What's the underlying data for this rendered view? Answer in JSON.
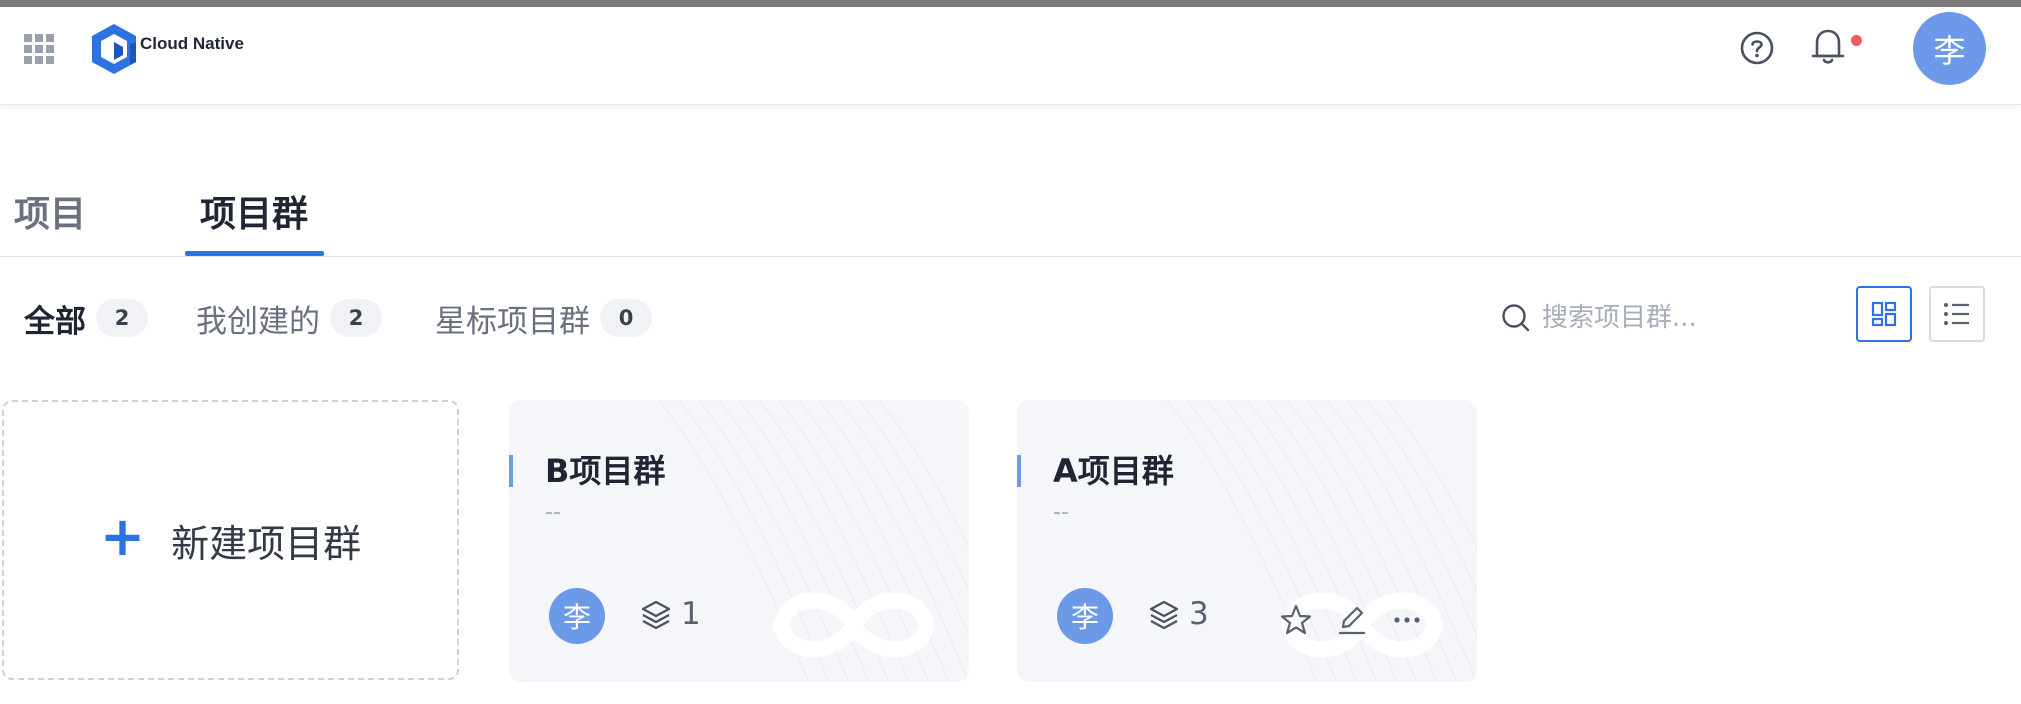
{
  "header": {
    "brand": "Cloud Native",
    "user_initial": "李"
  },
  "tabs": [
    {
      "label": "项目",
      "active": false
    },
    {
      "label": "项目群",
      "active": true
    }
  ],
  "filters": [
    {
      "label": "全部",
      "count": "2",
      "active": true
    },
    {
      "label": "我创建的",
      "count": "2",
      "active": false
    },
    {
      "label": "星标项目群",
      "count": "0",
      "active": false
    }
  ],
  "search": {
    "placeholder": "搜索项目群...",
    "value": ""
  },
  "view_mode": "grid",
  "new_card": {
    "label": "新建项目群"
  },
  "cards": [
    {
      "title": "B项目群",
      "description": "--",
      "owner_initial": "李",
      "project_count": "1",
      "shows_actions": false
    },
    {
      "title": "A项目群",
      "description": "--",
      "owner_initial": "李",
      "project_count": "3",
      "shows_actions": true
    }
  ],
  "colors": {
    "accent": "#2c72e0",
    "avatar": "#6d9ae8",
    "notification_dot": "#f15b5b"
  }
}
